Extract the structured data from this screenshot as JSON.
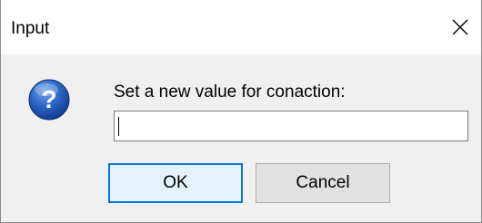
{
  "window": {
    "title": "Input",
    "close_icon": "close-icon"
  },
  "dialog": {
    "icon": "question-icon",
    "prompt": "Set a new value for conaction:",
    "input_value": "",
    "ok_label": "OK",
    "cancel_label": "Cancel"
  },
  "colors": {
    "titlebar_bg": "#ffffff",
    "content_bg": "#f0f0f0",
    "ok_border": "#0078d7",
    "ok_bg": "#e5f1fb",
    "cancel_bg": "#e1e1e1",
    "icon_blue": "#1f5fbf"
  }
}
